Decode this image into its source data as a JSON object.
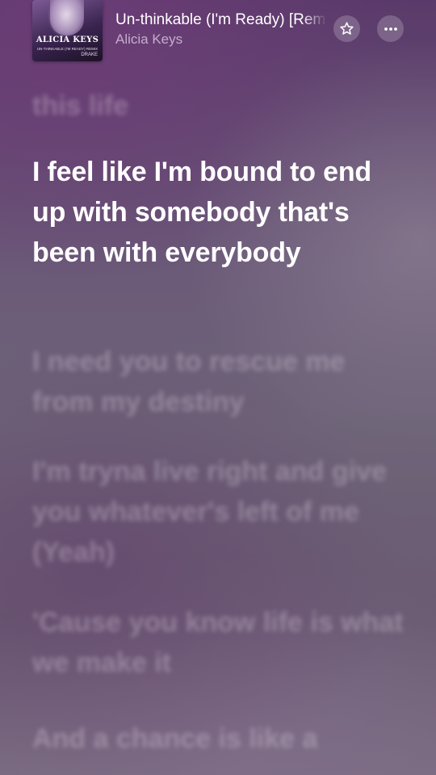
{
  "album": {
    "art_title": "ALICIA KEYS",
    "art_subtitle": "UN-THINKABLE (I'M READY) REMIX",
    "art_feature": "DRAKE"
  },
  "track": {
    "title": "Un-thinkable (I'm Ready) [Remix]",
    "artist": "Alicia Keys"
  },
  "icons": {
    "favorite": "star-outline-icon",
    "more": "ellipsis-icon"
  },
  "lyrics": [
    {
      "text": "this life",
      "state": "past"
    },
    {
      "text": "I feel like I'm bound to end up with somebody that's been with everybody",
      "state": "current"
    },
    {
      "text": "I need you to rescue me from my destiny",
      "state": "upcoming"
    },
    {
      "text": "I'm tryna live right and give you whatever's left of me (Yeah)",
      "state": "upcoming"
    },
    {
      "text": "'Cause you know life is what we make it",
      "state": "upcoming"
    },
    {
      "text": "And a chance is like a",
      "state": "upcoming"
    }
  ]
}
